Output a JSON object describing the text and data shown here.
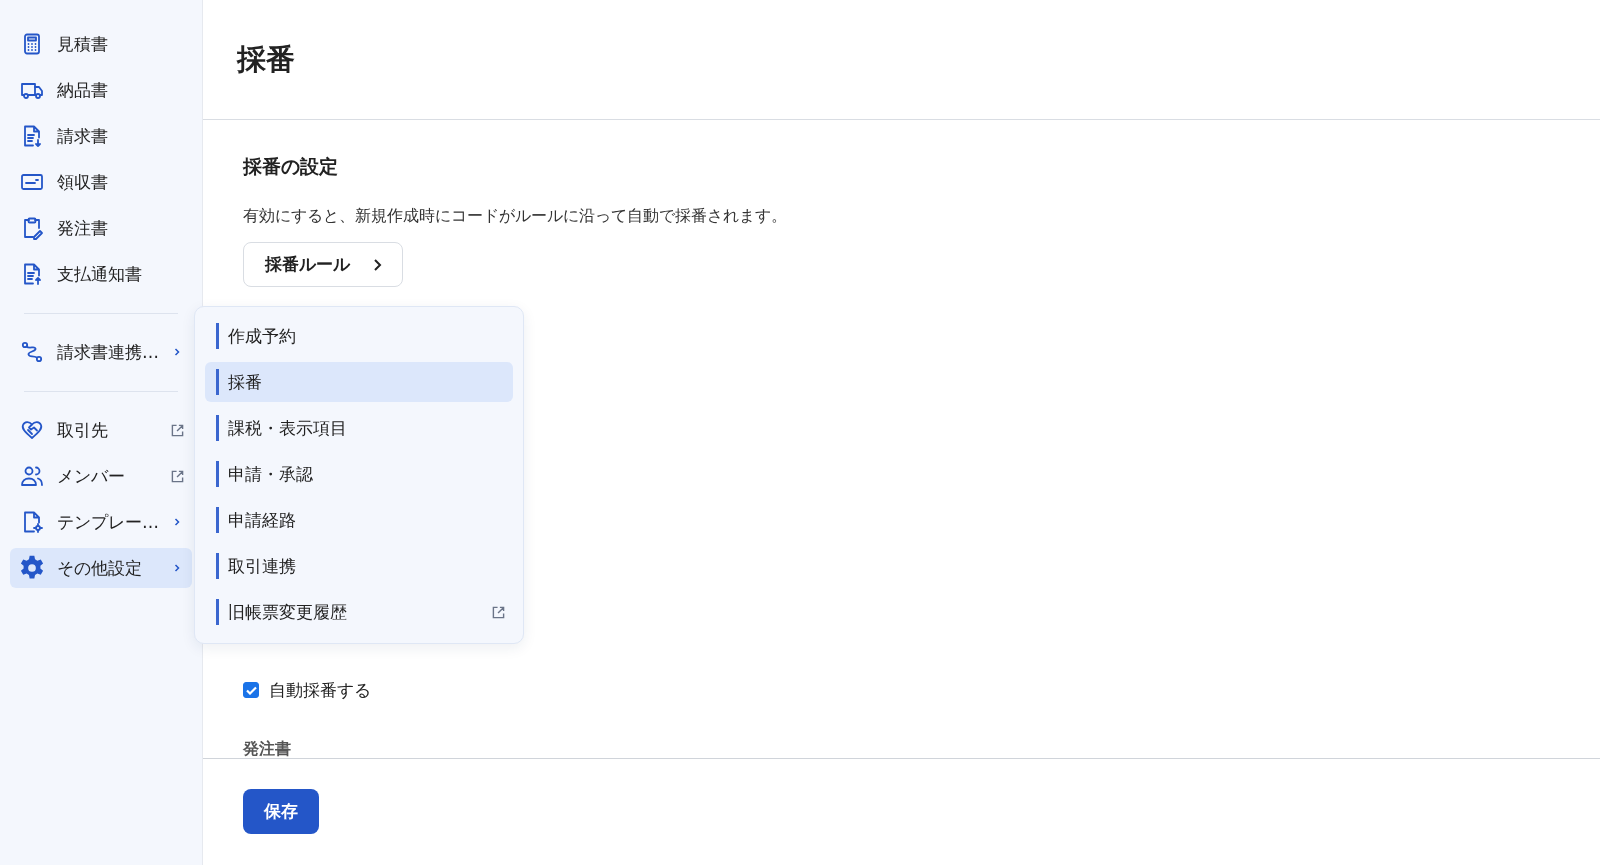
{
  "sidebar": {
    "sections": [
      [
        {
          "label": "見積書",
          "kind": "link",
          "selected": false
        },
        {
          "label": "納品書",
          "kind": "link",
          "selected": false
        },
        {
          "label": "請求書",
          "kind": "link",
          "selected": false
        },
        {
          "label": "領収書",
          "kind": "link",
          "selected": false
        },
        {
          "label": "発注書",
          "kind": "link",
          "selected": false
        },
        {
          "label": "支払通知書",
          "kind": "link",
          "selected": false
        }
      ],
      [
        {
          "label": "請求書連携…",
          "kind": "submenu",
          "selected": false
        }
      ],
      [
        {
          "label": "取引先",
          "kind": "external",
          "selected": false
        },
        {
          "label": "メンバー",
          "kind": "external",
          "selected": false
        },
        {
          "label": "テンプレー…",
          "kind": "submenu",
          "selected": false
        },
        {
          "label": "その他設定",
          "kind": "submenu",
          "selected": true
        }
      ]
    ]
  },
  "popup": {
    "items": [
      {
        "label": "作成予約",
        "kind": "link",
        "selected": false
      },
      {
        "label": "採番",
        "kind": "link",
        "selected": true
      },
      {
        "label": "課税・表示項目",
        "kind": "link",
        "selected": false
      },
      {
        "label": "申請・承認",
        "kind": "link",
        "selected": false
      },
      {
        "label": "申請経路",
        "kind": "link",
        "selected": false
      },
      {
        "label": "取引連携",
        "kind": "link",
        "selected": false
      },
      {
        "label": "旧帳票変更履歴",
        "kind": "external",
        "selected": false
      }
    ]
  },
  "page": {
    "title": "採番",
    "section_title": "採番の設定",
    "description": "有効にすると、新規作成時にコードがルールに沿って自動で採番されます。",
    "rule_button": "採番ルール",
    "options": [
      {
        "label": "自動採番する",
        "checked": true
      }
    ],
    "next_heading": "発注書"
  },
  "footer": {
    "save_button": "保存"
  }
}
